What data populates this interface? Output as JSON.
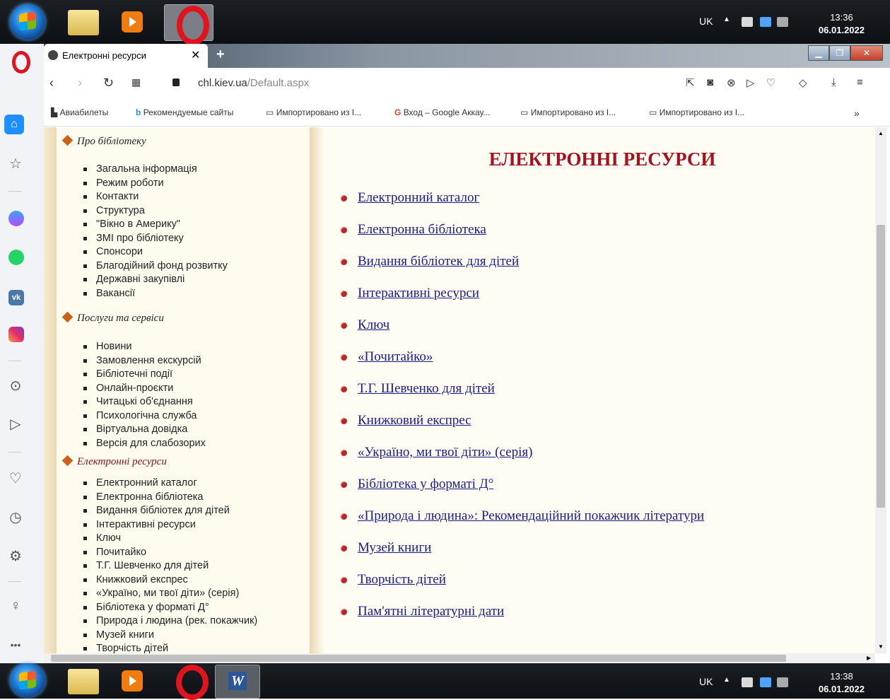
{
  "taskbar_top": {
    "lang": "UK",
    "time": "13:36",
    "date": "06.01.2022"
  },
  "taskbar_bottom": {
    "lang": "UK",
    "time": "13:38",
    "date": "06.01.2022"
  },
  "tab": {
    "title": "Електронні ресурси"
  },
  "address": {
    "domain": "chl.kiev.ua",
    "path": "/Default.aspx"
  },
  "bookmarks": [
    "Авиабилеты",
    "Рекомендуемые сайты",
    "Импортировано из I...",
    "Вход – Google Аккау...",
    "Импортировано из I...",
    "Импортировано из I..."
  ],
  "sidebar": {
    "sections": [
      {
        "title": "Про бібліотеку",
        "items": [
          "Загальна інформація",
          "Режим роботи",
          "Контакти",
          "Структура",
          "\"Вікно в Америку\"",
          "ЗМІ про бібліотеку",
          "Спонсори",
          "Благодійний фонд розвитку",
          "Державні закупівлі",
          "Вакансії"
        ]
      },
      {
        "title": "Послуги та сервіси",
        "items": [
          "Новини",
          "Замовлення екскурсій",
          "Бібліотечні події",
          "Онлайн-проєкти",
          "Читацькі об'єднання",
          "Психологічна служба",
          "Віртуальна довідка",
          "Версія для слабозорих"
        ]
      },
      {
        "title": "Електронні ресурси",
        "items": [
          "Електронний каталог",
          "Електронна бібліотека",
          "Видання бібліотек для дітей",
          "Інтерактивні ресурси",
          "Ключ",
          "Почитайко",
          "Т.Г. Шевченко для дітей",
          "Книжковий експрес",
          "«Україно, ми твої діти» (серія)",
          "Бібліотека у форматі Д°",
          "Природа і людина (рек. покажчик)",
          "Музей книги",
          "Творчість дітей"
        ]
      }
    ]
  },
  "main": {
    "title": "ЕЛЕКТРОННІ РЕСУРСИ",
    "links": [
      "Електронний каталог",
      "Електронна бібліотека",
      "Видання бібліотек для дітей",
      "Інтерактивні ресурси",
      "Ключ",
      "«Почитайко»",
      "Т.Г. Шевченко для дітей",
      "Книжковий експрес",
      "«Україно, ми твої діти» (серія)",
      "Бібліотека у форматі Д°",
      "«Природа і людина»: Рекомендаційний покажчик літератури",
      "Музей книги",
      "Творчість дітей",
      "Пам'ятні літературні дати"
    ]
  }
}
